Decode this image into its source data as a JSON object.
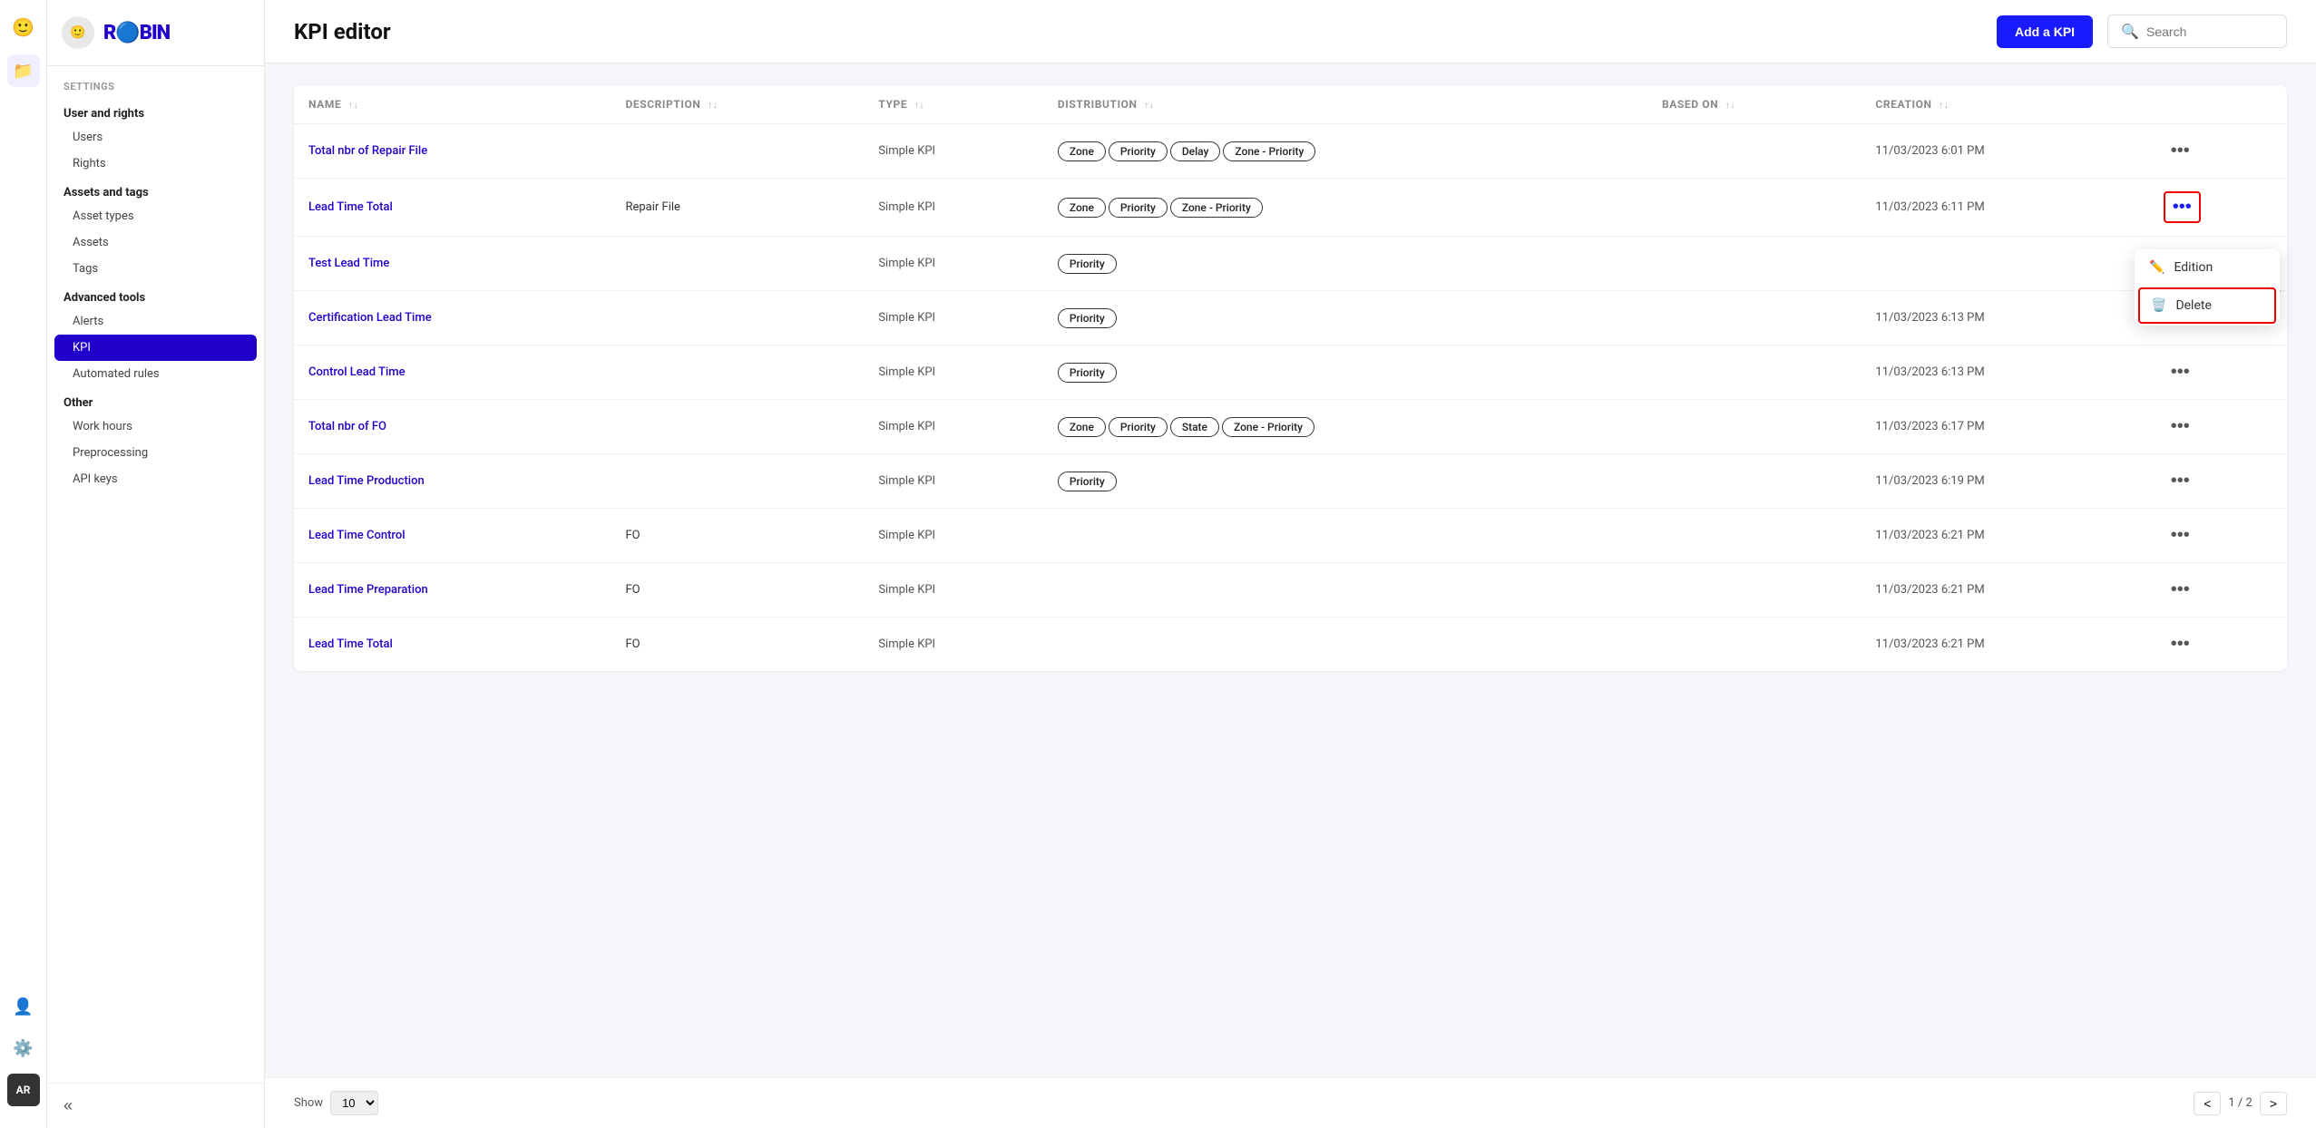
{
  "app": {
    "logo_text": "ROBIN",
    "logo_initials": "AR"
  },
  "sidebar": {
    "section_label": "SETTINGS",
    "groups": [
      {
        "label": "User and rights",
        "items": [
          "Users",
          "Rights"
        ]
      },
      {
        "label": "Assets and tags",
        "items": [
          "Asset types",
          "Assets",
          "Tags"
        ]
      },
      {
        "label": "Advanced tools",
        "items": [
          "Alerts",
          "KPI",
          "Automated rules"
        ]
      },
      {
        "label": "Other",
        "items": [
          "Work hours",
          "Preprocessing",
          "API keys"
        ]
      }
    ],
    "active_item": "KPI",
    "collapse_icon": "«"
  },
  "header": {
    "title": "KPI editor",
    "add_button": "Add a KPI",
    "search_placeholder": "Search"
  },
  "table": {
    "columns": [
      {
        "id": "name",
        "label": "NAME",
        "sortable": true
      },
      {
        "id": "description",
        "label": "DESCRIPTION",
        "sortable": true
      },
      {
        "id": "type",
        "label": "TYPE",
        "sortable": true
      },
      {
        "id": "distribution",
        "label": "DISTRIBUTION",
        "sortable": true
      },
      {
        "id": "based_on",
        "label": "BASED ON",
        "sortable": true
      },
      {
        "id": "creation",
        "label": "CREATION",
        "sortable": true
      },
      {
        "id": "actions",
        "label": "",
        "sortable": false
      }
    ],
    "rows": [
      {
        "name": "Total nbr of Repair File",
        "description": "",
        "type": "Simple KPI",
        "tags": [
          "Zone",
          "Priority",
          "Delay",
          "Zone - Priority"
        ],
        "based_on": "",
        "creation": "11/03/2023 6:01 PM",
        "actions": "..."
      },
      {
        "name": "Lead Time Total",
        "description": "Repair File",
        "type": "Simple KPI",
        "tags": [
          "Zone",
          "Priority",
          "Zone - Priority"
        ],
        "based_on": "",
        "creation": "11/03/2023 6:11 PM",
        "actions": "...",
        "highlighted": true
      },
      {
        "name": "Test Lead Time",
        "description": "",
        "type": "Simple KPI",
        "tags": [
          "Priority"
        ],
        "based_on": "",
        "creation": "",
        "actions": "..."
      },
      {
        "name": "Certification Lead Time",
        "description": "",
        "type": "Simple KPI",
        "tags": [
          "Priority"
        ],
        "based_on": "",
        "creation": "11/03/2023 6:13 PM",
        "actions": "..."
      },
      {
        "name": "Control Lead Time",
        "description": "",
        "type": "Simple KPI",
        "tags": [
          "Priority"
        ],
        "based_on": "",
        "creation": "11/03/2023 6:13 PM",
        "actions": "..."
      },
      {
        "name": "Total nbr of FO",
        "description": "",
        "type": "Simple KPI",
        "tags": [
          "Zone",
          "Priority",
          "State",
          "Zone - Priority"
        ],
        "based_on": "",
        "creation": "11/03/2023 6:17 PM",
        "actions": "..."
      },
      {
        "name": "Lead Time Production",
        "description": "",
        "type": "Simple KPI",
        "tags": [
          "Priority"
        ],
        "based_on": "",
        "creation": "11/03/2023 6:19 PM",
        "actions": "..."
      },
      {
        "name": "Lead Time Control",
        "description": "FO",
        "type": "Simple KPI",
        "tags": [],
        "based_on": "",
        "creation": "11/03/2023 6:21 PM",
        "actions": "..."
      },
      {
        "name": "Lead Time Preparation",
        "description": "FO",
        "type": "Simple KPI",
        "tags": [],
        "based_on": "",
        "creation": "11/03/2023 6:21 PM",
        "actions": "..."
      },
      {
        "name": "Lead Time Total",
        "description": "FO",
        "type": "Simple KPI",
        "tags": [],
        "based_on": "",
        "creation": "11/03/2023 6:21 PM",
        "actions": "..."
      }
    ]
  },
  "dropdown": {
    "edition_label": "Edition",
    "delete_label": "Delete"
  },
  "pagination": {
    "show_label": "Show",
    "per_page": "10",
    "page_info": "1 / 2",
    "prev": "<",
    "next": ">"
  },
  "icons": {
    "sort": "↑↓",
    "more": "•••",
    "search": "🔍",
    "edit": "✏",
    "trash": "🗑",
    "person": "👤",
    "gear": "⚙",
    "folder": "📁",
    "chevron_left": "«"
  }
}
